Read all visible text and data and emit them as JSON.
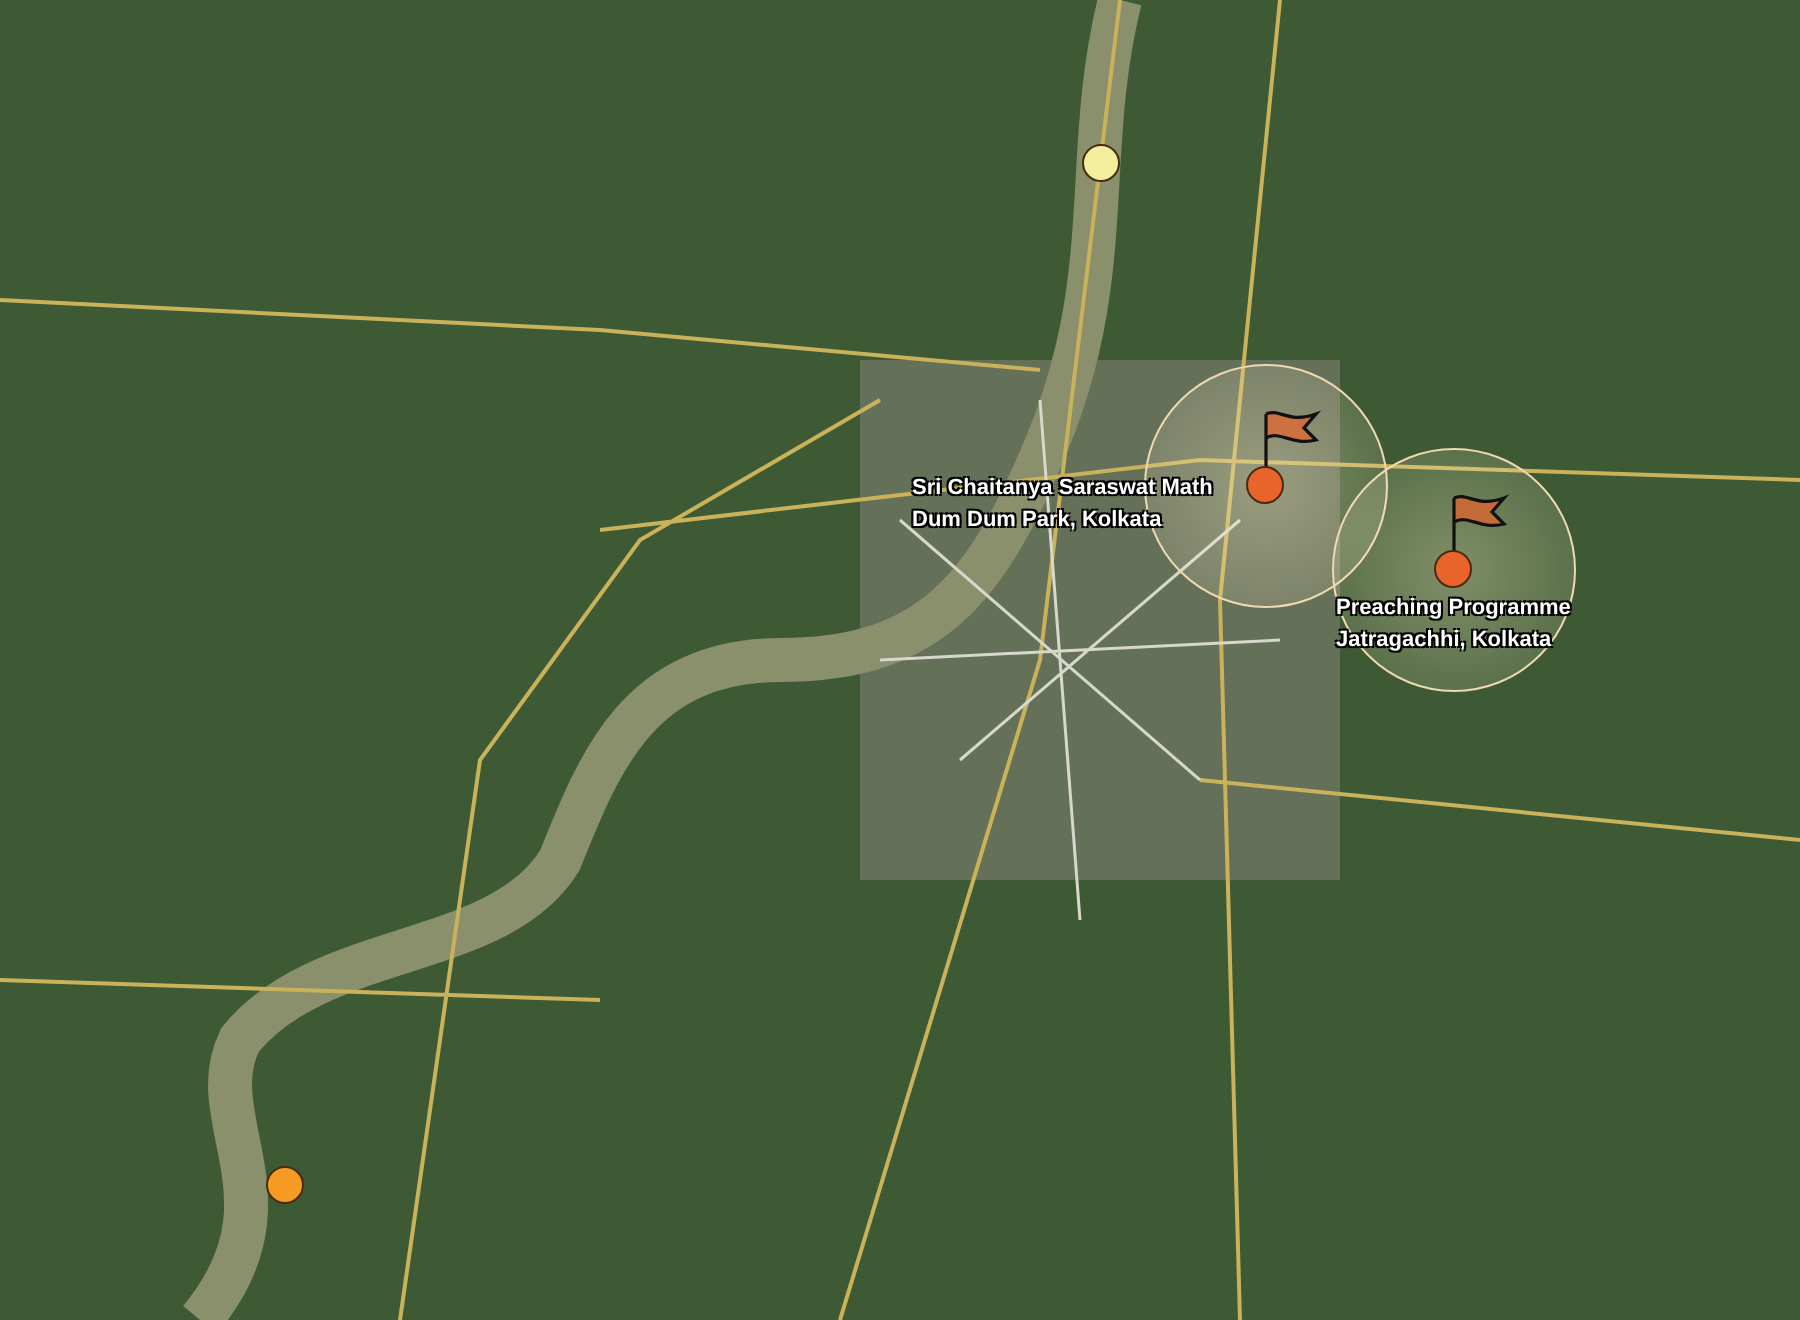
{
  "markers": [
    {
      "kind": "flag",
      "color": "#e8642a",
      "lines": [
        "Sri Chaitanya Saraswat Math",
        "Dum Dum Park, Kolkata"
      ]
    },
    {
      "kind": "flag",
      "color": "#e8642a",
      "lines": [
        "Preaching Programme",
        "Jatragachhi, Kolkata"
      ]
    },
    {
      "kind": "dot",
      "color": "#f4ef9c"
    },
    {
      "kind": "dot",
      "color": "#f59a23"
    }
  ]
}
